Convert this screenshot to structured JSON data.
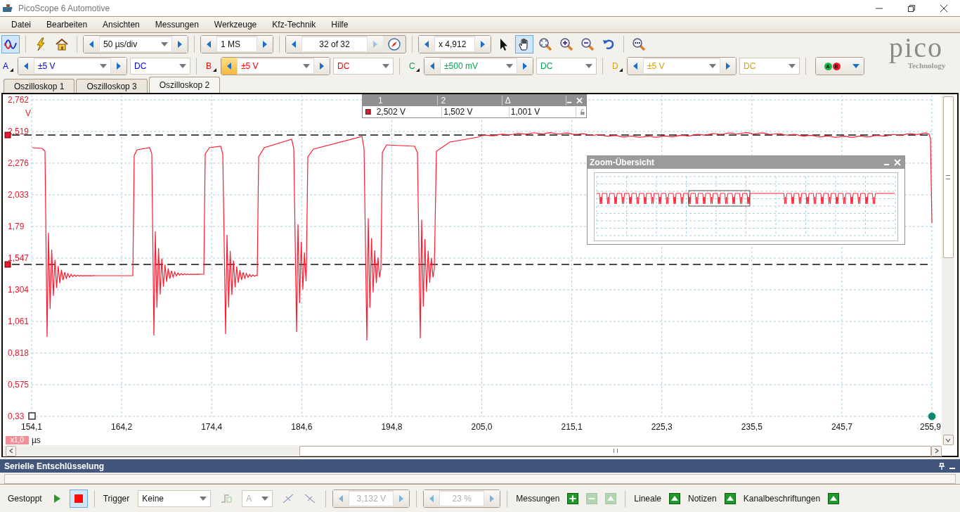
{
  "window": {
    "title": "PicoScope 6 Automotive"
  },
  "menu": [
    "Datei",
    "Bearbeiten",
    "Ansichten",
    "Messungen",
    "Werkzeuge",
    "Kfz-Technik",
    "Hilfe"
  ],
  "toolbar": {
    "scope_mode_selected": true,
    "timebase": "50 µs/div",
    "samples": "1 MS",
    "buffer": "32 of 32",
    "buffer_next_disabled": true,
    "zoom_factor": "x 4,912",
    "tools": [
      {
        "kind": "pointer",
        "selected": false
      },
      {
        "kind": "hand",
        "selected": true
      },
      {
        "kind": "zoom_box",
        "selected": false
      },
      {
        "kind": "zoom_in",
        "selected": false
      },
      {
        "kind": "zoom_out",
        "selected": false
      },
      {
        "kind": "undo",
        "selected": false
      },
      {
        "kind": "zoom_full",
        "selected": false
      }
    ]
  },
  "logo": {
    "name": "pico",
    "tagline": "Technology"
  },
  "channels": [
    {
      "letter": "A",
      "range": "±5 V",
      "coupling": "DC",
      "color": "#0000ff",
      "highlighted": false
    },
    {
      "letter": "B",
      "range": "±5 V",
      "coupling": "DC",
      "color": "#ff0000",
      "highlighted": true
    },
    {
      "letter": "C",
      "range": "±500 mV",
      "coupling": "DC",
      "color": "#00a651",
      "highlighted": false
    },
    {
      "letter": "D",
      "range": "±5 V",
      "coupling": "DC",
      "color": "#d4a017",
      "highlighted": false
    }
  ],
  "channel_toggle": [
    "A",
    "B"
  ],
  "tabs": [
    {
      "label": "Oszilloskop 1",
      "selected": false
    },
    {
      "label": "Oszilloskop 3",
      "selected": false
    },
    {
      "label": "Oszilloskop 2",
      "selected": true
    }
  ],
  "scope": {
    "y_unit": "V",
    "y_labels": [
      "2,762",
      "2,519",
      "2,276",
      "2,033",
      "1,79",
      "1,547",
      "1,304",
      "1,061",
      "0,818",
      "0,575",
      "0,33"
    ],
    "x_labels": [
      "154,1",
      "164,2",
      "174,4",
      "184,6",
      "194,8",
      "205,0",
      "215,1",
      "225,3",
      "235,5",
      "245,7",
      "255,9"
    ],
    "x_unit": "µs",
    "x_scale": "x1,0"
  },
  "ruler_table": {
    "columns": [
      "1",
      "2",
      "Δ"
    ],
    "values": [
      "2,502 V",
      "1,502 V",
      "1,001 V"
    ]
  },
  "zoom_overview": {
    "title": "Zoom-Übersicht"
  },
  "serial_panel": {
    "title": "Serielle Entschlüsselung"
  },
  "status_bar": {
    "state": "Gestoppt",
    "running": false,
    "trigger_label": "Trigger",
    "trigger_mode": "Keine",
    "trigger_channel": "A",
    "threshold": "3,132 V",
    "pretrigger": "23 %",
    "trigger_controls_disabled": true,
    "measurements_label": "Messungen",
    "measurement_buttons": [
      {
        "kind": "add",
        "disabled": false
      },
      {
        "kind": "remove",
        "disabled": true
      },
      {
        "kind": "up",
        "disabled": true
      }
    ],
    "rulers_label": "Lineale",
    "notes_label": "Notizen",
    "channel_labels_label": "Kanalbeschriftungen"
  }
}
